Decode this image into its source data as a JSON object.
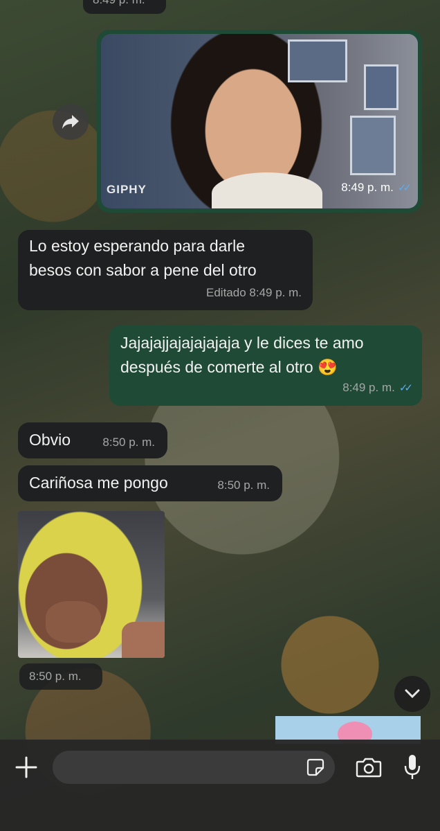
{
  "messages": {
    "top_partial_time": "8:49 p. m.",
    "gif": {
      "brand": "GIPHY",
      "time": "8:49 p. m."
    },
    "msg1": {
      "text_line1": "Lo estoy esperando para darle",
      "text_line2": "besos con sabor a pene del otro",
      "meta": "Editado 8:49 p. m."
    },
    "msg2": {
      "text_line1": "Jajajajjajajajajaja y le dices te amo",
      "text_line2": "después de comerte al otro 😍",
      "time": "8:49 p. m."
    },
    "msg3": {
      "text": "Obvio",
      "time": "8:50 p. m."
    },
    "msg4": {
      "text": "Cariñosa me pongo",
      "time": "8:50 p. m."
    },
    "sticker": {
      "time": "8:50 p. m."
    }
  },
  "input": {
    "placeholder": ""
  },
  "icons": [
    "forward-icon",
    "scroll-down-icon",
    "plus-icon",
    "sticker-icon",
    "camera-icon",
    "microphone-icon"
  ],
  "colors": {
    "incoming": "#1f2021",
    "outgoing": "#1e4a36",
    "read_ticks": "#5aaef2"
  }
}
